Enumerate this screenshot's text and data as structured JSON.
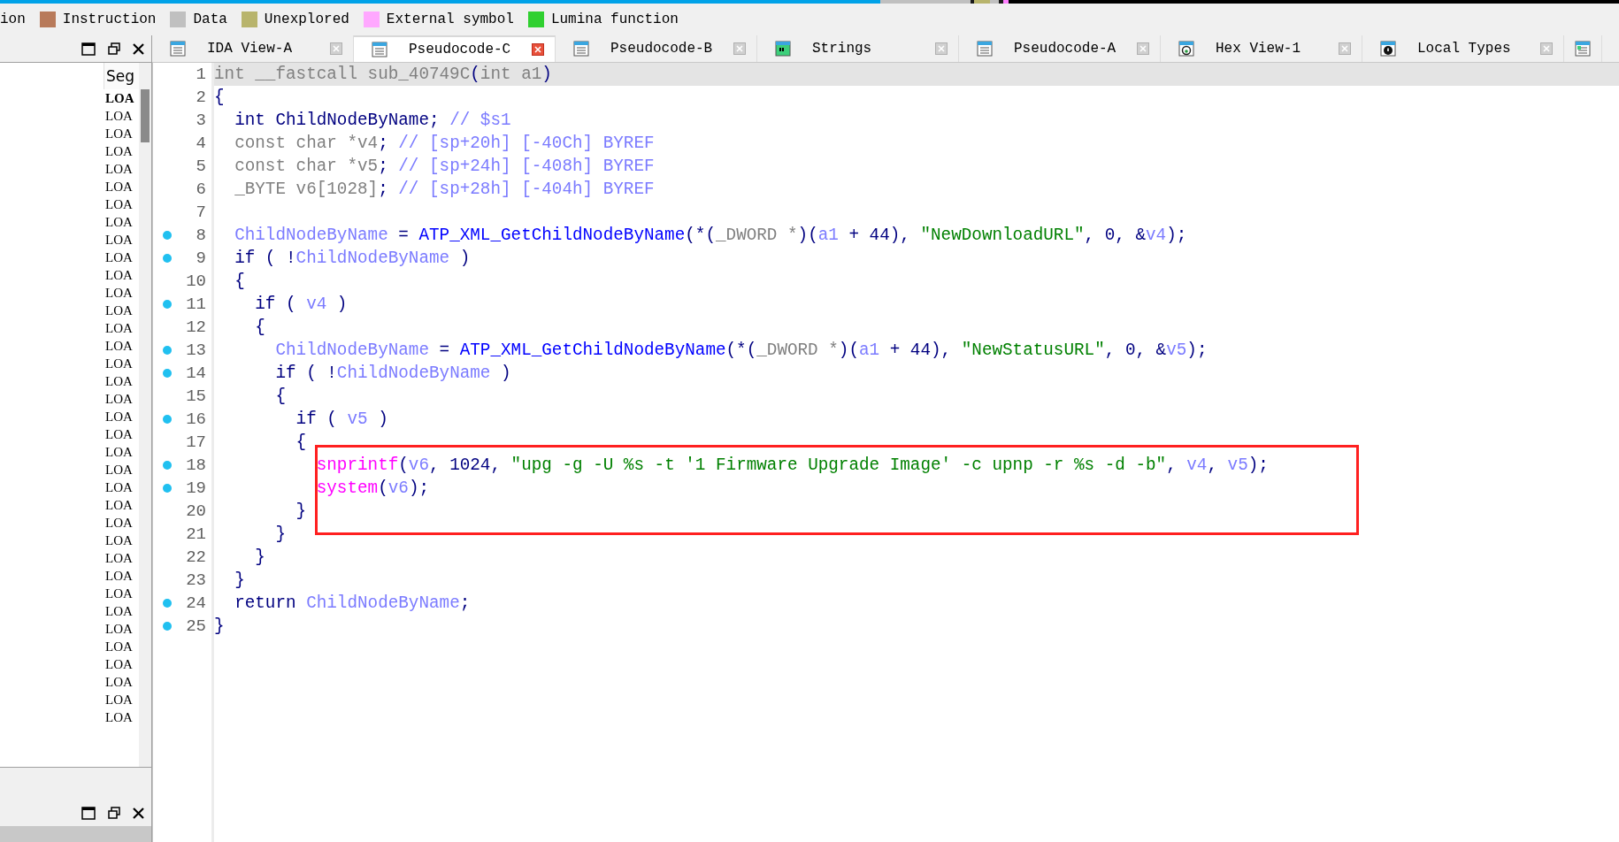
{
  "legend": [
    {
      "label": "ion"
    },
    {
      "label": "Instruction",
      "color": "#b87a5a"
    },
    {
      "label": "Data",
      "color": "#c0c0c0"
    },
    {
      "label": "Unexplored",
      "color": "#b8b46c"
    },
    {
      "label": "External symbol",
      "color": "#ffa8ff"
    },
    {
      "label": "Lumina function",
      "color": "#30d030"
    }
  ],
  "segments_panel": {
    "column": "Seg",
    "rows": [
      {
        "text": "LOA",
        "selected": true
      },
      {
        "text": "LOA",
        "selected": false
      },
      {
        "text": "LOA",
        "selected": false
      },
      {
        "text": "LOA",
        "selected": false
      },
      {
        "text": "LOA",
        "selected": false
      },
      {
        "text": "LOA",
        "selected": false
      },
      {
        "text": "LOA",
        "selected": false
      },
      {
        "text": "LOA",
        "selected": false
      },
      {
        "text": "LOA",
        "selected": false
      },
      {
        "text": "LOA",
        "selected": false
      },
      {
        "text": "LOA",
        "selected": false
      },
      {
        "text": "LOA",
        "selected": false
      },
      {
        "text": "LOA",
        "selected": false
      },
      {
        "text": "LOA",
        "selected": false
      },
      {
        "text": "LOA",
        "selected": false
      },
      {
        "text": "LOA",
        "selected": false
      },
      {
        "text": "LOA",
        "selected": false
      },
      {
        "text": "LOA",
        "selected": false
      },
      {
        "text": "LOA",
        "selected": false
      },
      {
        "text": "LOA",
        "selected": false
      },
      {
        "text": "LOA",
        "selected": false
      },
      {
        "text": "LOA",
        "selected": false
      },
      {
        "text": "LOA",
        "selected": false
      },
      {
        "text": "LOA",
        "selected": false
      },
      {
        "text": "LOA",
        "selected": false
      },
      {
        "text": "LOA",
        "selected": false
      },
      {
        "text": "LOA",
        "selected": false
      },
      {
        "text": "LOA",
        "selected": false
      },
      {
        "text": "LOA",
        "selected": false
      },
      {
        "text": "LOA",
        "selected": false
      },
      {
        "text": "LOA",
        "selected": false
      },
      {
        "text": "LOA",
        "selected": false
      },
      {
        "text": "LOA",
        "selected": false
      },
      {
        "text": "LOA",
        "selected": false
      },
      {
        "text": "LOA",
        "selected": false
      },
      {
        "text": "LOA",
        "selected": false
      }
    ]
  },
  "tabs": [
    {
      "label": "IDA View-A",
      "kind": "listing",
      "selected": false
    },
    {
      "label": "Pseudocode-C",
      "kind": "listing",
      "selected": true
    },
    {
      "label": "Pseudocode-B",
      "kind": "listing",
      "selected": false
    },
    {
      "label": "Strings",
      "kind": "strings",
      "selected": false
    },
    {
      "label": "Pseudocode-A",
      "kind": "listing",
      "selected": false
    },
    {
      "label": "Hex View-1",
      "kind": "hex",
      "selected": false
    },
    {
      "label": "Local Types",
      "kind": "types",
      "selected": false
    },
    {
      "kind": "structures",
      "selected": false
    }
  ],
  "code": {
    "lines": [
      {
        "number": "1",
        "dot": false,
        "selected": true,
        "boxed": false,
        "tokens": [
          {
            "kind": "muted",
            "t": "int __fastcall sub_40749C"
          },
          {
            "kind": "plain",
            "t": "("
          },
          {
            "kind": "muted",
            "t": "int a1"
          },
          {
            "kind": "plain",
            "t": ")"
          }
        ]
      },
      {
        "number": "2",
        "dot": false,
        "selected": false,
        "boxed": false,
        "tokens": [
          {
            "kind": "plain",
            "t": "{"
          }
        ]
      },
      {
        "number": "3",
        "dot": false,
        "selected": false,
        "boxed": false,
        "tokens": [
          {
            "kind": "plain",
            "t": "  int ChildNodeByName; "
          },
          {
            "kind": "local",
            "t": "// $s1"
          }
        ]
      },
      {
        "number": "4",
        "dot": false,
        "selected": false,
        "boxed": false,
        "tokens": [
          {
            "kind": "muted",
            "t": "  const char *v4"
          },
          {
            "kind": "plain",
            "t": "; "
          },
          {
            "kind": "local",
            "t": "// [sp+20h] [-40Ch] BYREF"
          }
        ]
      },
      {
        "number": "5",
        "dot": false,
        "selected": false,
        "boxed": false,
        "tokens": [
          {
            "kind": "muted",
            "t": "  const char *v5"
          },
          {
            "kind": "plain",
            "t": "; "
          },
          {
            "kind": "local",
            "t": "// [sp+24h] [-408h] BYREF"
          }
        ]
      },
      {
        "number": "6",
        "dot": false,
        "selected": false,
        "boxed": false,
        "tokens": [
          {
            "kind": "muted",
            "t": "  _BYTE v6[1028]"
          },
          {
            "kind": "plain",
            "t": "; "
          },
          {
            "kind": "local",
            "t": "// [sp+28h] [-404h] BYREF"
          }
        ]
      },
      {
        "number": "7",
        "dot": false,
        "selected": false,
        "boxed": false
      },
      {
        "number": "8",
        "dot": true,
        "selected": false,
        "boxed": false,
        "tokens": [
          {
            "kind": "local",
            "t": "  ChildNodeByName"
          },
          {
            "kind": "plain",
            "t": " = "
          },
          {
            "kind": "global",
            "t": "ATP_XML_GetChildNodeByName"
          },
          {
            "kind": "plain",
            "t": "(*("
          },
          {
            "kind": "muted",
            "t": "_DWORD *"
          },
          {
            "kind": "plain",
            "t": ")("
          },
          {
            "kind": "local",
            "t": "a1"
          },
          {
            "kind": "plain",
            "t": " + 44), "
          },
          {
            "kind": "string",
            "t": "\"NewDownloadURL\""
          },
          {
            "kind": "plain",
            "t": ", 0, &"
          },
          {
            "kind": "local",
            "t": "v4"
          },
          {
            "kind": "plain",
            "t": ");"
          }
        ]
      },
      {
        "number": "9",
        "dot": true,
        "selected": false,
        "boxed": false,
        "tokens": [
          {
            "kind": "plain",
            "t": "  if ( !"
          },
          {
            "kind": "local",
            "t": "ChildNodeByName"
          },
          {
            "kind": "plain",
            "t": " )"
          }
        ]
      },
      {
        "number": "10",
        "dot": false,
        "selected": false,
        "boxed": false,
        "tokens": [
          {
            "kind": "plain",
            "t": "  {"
          }
        ]
      },
      {
        "number": "11",
        "dot": true,
        "selected": false,
        "boxed": false,
        "tokens": [
          {
            "kind": "plain",
            "t": "    if ( "
          },
          {
            "kind": "local",
            "t": "v4"
          },
          {
            "kind": "plain",
            "t": " )"
          }
        ]
      },
      {
        "number": "12",
        "dot": false,
        "selected": false,
        "boxed": false,
        "tokens": [
          {
            "kind": "plain",
            "t": "    {"
          }
        ]
      },
      {
        "number": "13",
        "dot": true,
        "selected": false,
        "boxed": false,
        "tokens": [
          {
            "kind": "local",
            "t": "      ChildNodeByName"
          },
          {
            "kind": "plain",
            "t": " = "
          },
          {
            "kind": "global",
            "t": "ATP_XML_GetChildNodeByName"
          },
          {
            "kind": "plain",
            "t": "(*("
          },
          {
            "kind": "muted",
            "t": "_DWORD *"
          },
          {
            "kind": "plain",
            "t": ")("
          },
          {
            "kind": "local",
            "t": "a1"
          },
          {
            "kind": "plain",
            "t": " + 44), "
          },
          {
            "kind": "string",
            "t": "\"NewStatusURL\""
          },
          {
            "kind": "plain",
            "t": ", 0, &"
          },
          {
            "kind": "local",
            "t": "v5"
          },
          {
            "kind": "plain",
            "t": ");"
          }
        ]
      },
      {
        "number": "14",
        "dot": true,
        "selected": false,
        "boxed": false,
        "tokens": [
          {
            "kind": "plain",
            "t": "      if ( !"
          },
          {
            "kind": "local",
            "t": "ChildNodeByName"
          },
          {
            "kind": "plain",
            "t": " )"
          }
        ]
      },
      {
        "number": "15",
        "dot": false,
        "selected": false,
        "boxed": false,
        "tokens": [
          {
            "kind": "plain",
            "t": "      {"
          }
        ]
      },
      {
        "number": "16",
        "dot": true,
        "selected": false,
        "boxed": false,
        "tokens": [
          {
            "kind": "plain",
            "t": "        if ( "
          },
          {
            "kind": "local",
            "t": "v5"
          },
          {
            "kind": "plain",
            "t": " )"
          }
        ]
      },
      {
        "number": "17",
        "dot": false,
        "selected": false,
        "boxed": false,
        "tokens": [
          {
            "kind": "plain",
            "t": "        {"
          }
        ]
      },
      {
        "number": "18",
        "dot": true,
        "selected": false,
        "boxed": true,
        "tokens": [
          {
            "kind": "import",
            "t": "          snprintf"
          },
          {
            "kind": "plain",
            "t": "("
          },
          {
            "kind": "local",
            "t": "v6"
          },
          {
            "kind": "plain",
            "t": ", 1024, "
          },
          {
            "kind": "string",
            "t": "\"upg -g -U %s -t '1 Firmware Upgrade Image' -c upnp -r %s -d -b\""
          },
          {
            "kind": "plain",
            "t": ", "
          },
          {
            "kind": "local",
            "t": "v4"
          },
          {
            "kind": "plain",
            "t": ", "
          },
          {
            "kind": "local",
            "t": "v5"
          },
          {
            "kind": "plain",
            "t": ");"
          }
        ]
      },
      {
        "number": "19",
        "dot": true,
        "selected": false,
        "boxed": true,
        "tokens": [
          {
            "kind": "import",
            "t": "          system"
          },
          {
            "kind": "plain",
            "t": "("
          },
          {
            "kind": "local",
            "t": "v6"
          },
          {
            "kind": "plain",
            "t": ");"
          }
        ]
      },
      {
        "number": "20",
        "dot": false,
        "selected": false,
        "boxed": true,
        "tokens": [
          {
            "kind": "plain",
            "t": "        }"
          }
        ]
      },
      {
        "number": "21",
        "dot": false,
        "selected": false,
        "boxed": false,
        "tokens": [
          {
            "kind": "plain",
            "t": "      }"
          }
        ]
      },
      {
        "number": "22",
        "dot": false,
        "selected": false,
        "boxed": false,
        "tokens": [
          {
            "kind": "plain",
            "t": "    }"
          }
        ]
      },
      {
        "number": "23",
        "dot": false,
        "selected": false,
        "boxed": false,
        "tokens": [
          {
            "kind": "plain",
            "t": "  }"
          }
        ]
      },
      {
        "number": "24",
        "dot": true,
        "selected": false,
        "boxed": false,
        "tokens": [
          {
            "kind": "plain",
            "t": "  return "
          },
          {
            "kind": "local",
            "t": "ChildNodeByName"
          },
          {
            "kind": "plain",
            "t": ";"
          }
        ]
      },
      {
        "number": "25",
        "dot": true,
        "selected": false,
        "boxed": false,
        "tokens": [
          {
            "kind": "plain",
            "t": "}"
          }
        ]
      }
    ]
  }
}
